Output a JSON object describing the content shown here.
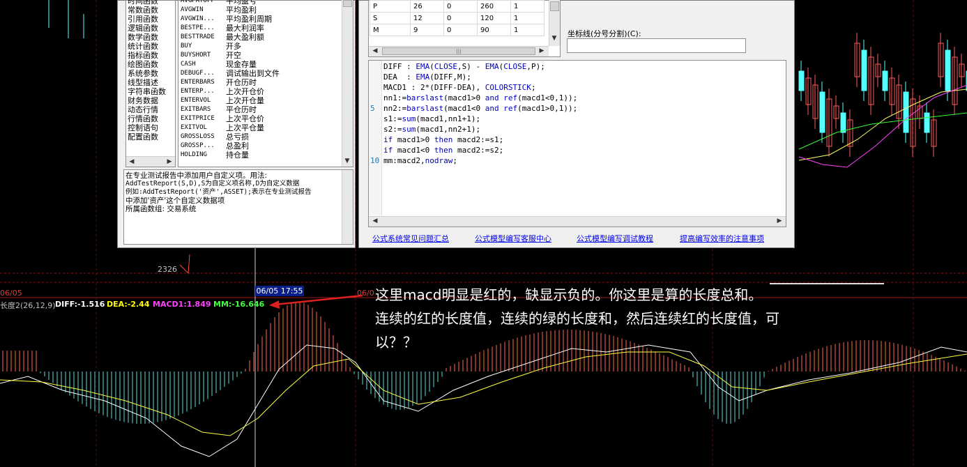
{
  "categories": [
    "时间函数",
    "常数函数",
    "引用函数",
    "逻辑函数",
    "数学函数",
    "统计函数",
    "指标函数",
    "绘图函数",
    "系统参数",
    "线型描述",
    "字符串函数",
    "财务数据",
    "动态行情",
    "行情函数",
    "控制语句",
    "配置函数"
  ],
  "functions": [
    {
      "name": "AVGPAYOFF",
      "desc": "平均盈亏"
    },
    {
      "name": "AVGWIN",
      "desc": "平均盈利"
    },
    {
      "name": "AVGWIN...",
      "desc": "平均盈利周期"
    },
    {
      "name": "BESTPE...",
      "desc": "最大利润率"
    },
    {
      "name": "BESTTRADE",
      "desc": "最大盈利额"
    },
    {
      "name": "BUY",
      "desc": "开多"
    },
    {
      "name": "BUYSHORT",
      "desc": "开空"
    },
    {
      "name": "CASH",
      "desc": "现金存量"
    },
    {
      "name": "DEBUGF...",
      "desc": "调试输出到文件"
    },
    {
      "name": "ENTERBARS",
      "desc": "开仓历时"
    },
    {
      "name": "ENTERP...",
      "desc": "上次开仓价"
    },
    {
      "name": "ENTERVOL",
      "desc": "上次开仓量"
    },
    {
      "name": "EXITBARS",
      "desc": "平仓历时"
    },
    {
      "name": "EXITPRICE",
      "desc": "上次平仓价"
    },
    {
      "name": "EXITVOL",
      "desc": "上次平仓量"
    },
    {
      "name": "GROSSLOSS",
      "desc": "总亏损"
    },
    {
      "name": "GROSSP...",
      "desc": "总盈利"
    },
    {
      "name": "HOLDING",
      "desc": "持仓量"
    }
  ],
  "description": [
    "在专业测试报告中添加用户自定义项。用法:",
    "AddTestReport(S,D),S为自定义项名称,D为自定义数据",
    "例如:AddTestReport('资产',ASSET);表示在专业测试报告",
    "中添加'资产'这个自定义数据项",
    "所属函数组: 交易系统"
  ],
  "params": [
    [
      "P",
      "26",
      "0",
      "260",
      "1"
    ],
    [
      "S",
      "12",
      "0",
      "120",
      "1"
    ],
    [
      "M",
      "9",
      "0",
      "90",
      "1"
    ]
  ],
  "axis_label": "坐标线(分号分割)(C):",
  "code_lines": [
    "DIFF : EMA(CLOSE,S) - EMA(CLOSE,P);",
    "DEA  : EMA(DIFF,M);",
    "MACD1 : 2*(DIFF-DEA), COLORSTICK;",
    "nn1:=barslast(macd1>0 and ref(macd1<0,1));",
    "nn2:=barslast(macd1<0 and ref(macd1>0,1));",
    "s1:=sum(macd1,nn1+1);",
    "s2:=sum(macd1,nn2+1);",
    "if macd1>0 then macd2:=s1;",
    "if macd1<0 then macd2:=s2;",
    "mm:macd2,nodraw;"
  ],
  "line_numbers": {
    "five": "5",
    "ten": "10"
  },
  "links": [
    "公式系统常见问题汇总",
    "公式模型编写客服中心",
    "公式模型编写调试教程",
    "提高编写效率的注意事项"
  ],
  "chart": {
    "price_label": "2326",
    "date_left": "06/05",
    "cursor_time": "06/05 17:55",
    "date_mid": "06/0",
    "indicator": "长度2(26,12,9)",
    "diff": "DIFF:-1.516",
    "dea": "DEA:-2.44",
    "macd1": "MACD1:1.849",
    "mm": "MM:-16.646"
  },
  "note": [
    "这里macd明显是红的，缺显示负的。你这里是算的长度总和。",
    "连续的红的长度值，连续的绿的长度和，然后连续红的长度值，可",
    "以？？"
  ],
  "colors": {
    "diff": "#ffffff",
    "dea": "#ffff00",
    "macd1": "#ff00ff",
    "mm": "#00ff00",
    "up": "#ff5a5a",
    "down": "#55ffff",
    "annotation_arrow": "#e02020"
  }
}
